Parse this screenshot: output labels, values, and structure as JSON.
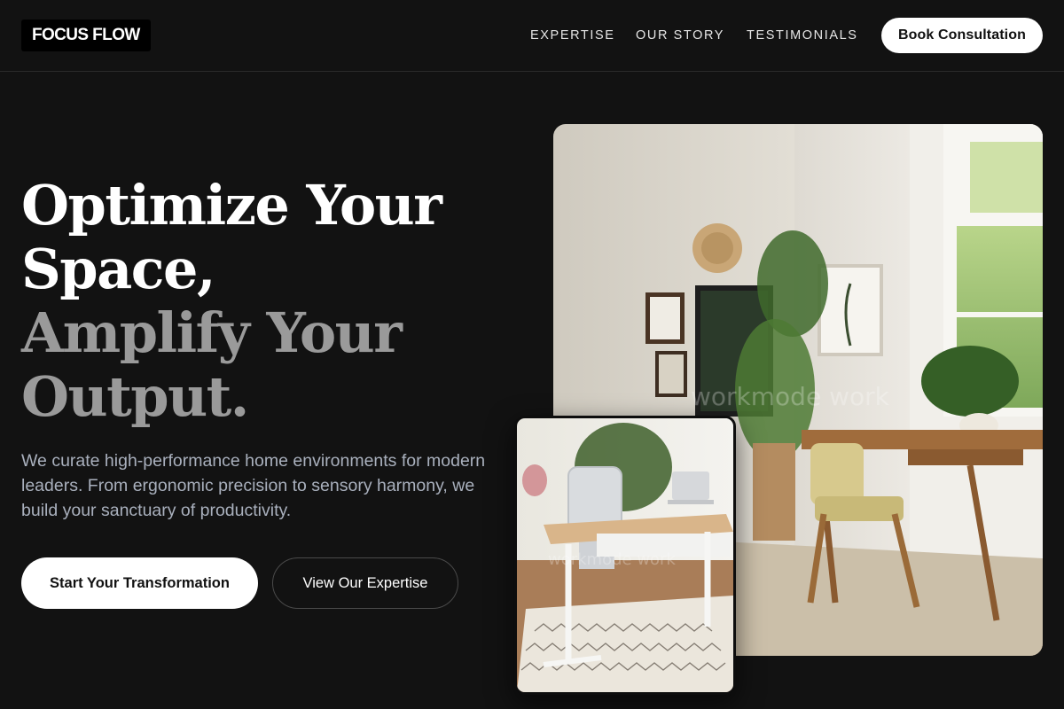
{
  "brand": {
    "logo_text": "FOCUS FLOW"
  },
  "nav": {
    "items": [
      "EXPERTISE",
      "OUR STORY",
      "TESTIMONIALS"
    ],
    "cta_label": "Book Consultation"
  },
  "hero": {
    "headline_line1": "Optimize Your",
    "headline_line2": "Space,",
    "headline_line3": "Amplify Your",
    "headline_line4": "Output.",
    "subcopy": "We curate high-performance home environments for modern leaders. From ergonomic precision to sensory harmony, we build your sanctuary of productivity.",
    "primary_cta": "Start Your Transformation",
    "secondary_cta": "View Our Expertise"
  },
  "images": {
    "main_watermark": "workmode work",
    "inset_watermark": "workmode work"
  },
  "colors": {
    "background": "#121212",
    "headline_accent": "#9a9a9a",
    "subcopy": "#a9b0bd",
    "button_light": "#ffffff"
  }
}
